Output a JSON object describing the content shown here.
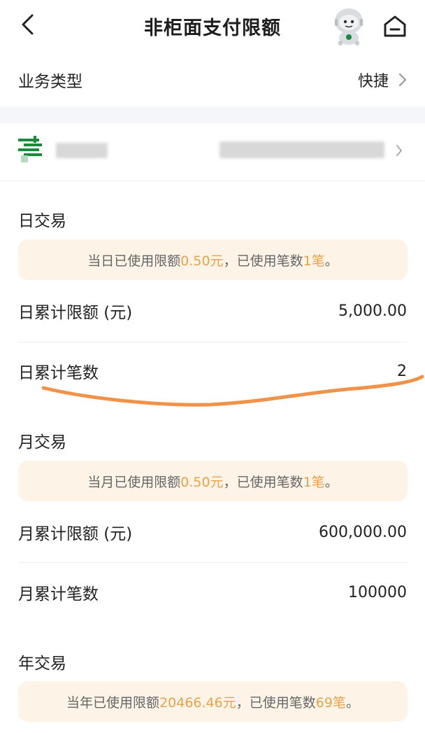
{
  "header": {
    "title": "非柜面支付限额"
  },
  "business": {
    "label": "业务类型",
    "value": "快捷"
  },
  "day": {
    "section": "日交易",
    "notice_prefix": "当日已使用限额",
    "notice_amount": "0.50元",
    "notice_mid": "，已使用笔数",
    "notice_count": "1笔",
    "notice_suffix": "。",
    "limit_label": "日累计限额 (元)",
    "limit_value": "5,000.00",
    "count_label": "日累计笔数",
    "count_value": "2"
  },
  "month": {
    "section": "月交易",
    "notice_prefix": "当月已使用限额",
    "notice_amount": "0.50元",
    "notice_mid": "，已使用笔数",
    "notice_count": "1笔",
    "notice_suffix": "。",
    "limit_label": "月累计限额 (元)",
    "limit_value": "600,000.00",
    "count_label": "月累计笔数",
    "count_value": "100000"
  },
  "year": {
    "section": "年交易",
    "notice_prefix": "当年已使用限额",
    "notice_amount": "20466.46元",
    "notice_mid": "，已使用笔数",
    "notice_count": "69笔",
    "notice_suffix": "。"
  },
  "icons": {
    "back": "chevron-left-icon",
    "home": "home-icon",
    "avatar": "robot-assistant-icon",
    "bank_logo": "postal-bank-logo-icon",
    "chevron": "chevron-right-icon"
  },
  "colors": {
    "highlight": "#e8a24a",
    "notice_bg": "#fdf3e7",
    "scribble": "#f0924a",
    "logo_green": "#1a8a3c"
  }
}
